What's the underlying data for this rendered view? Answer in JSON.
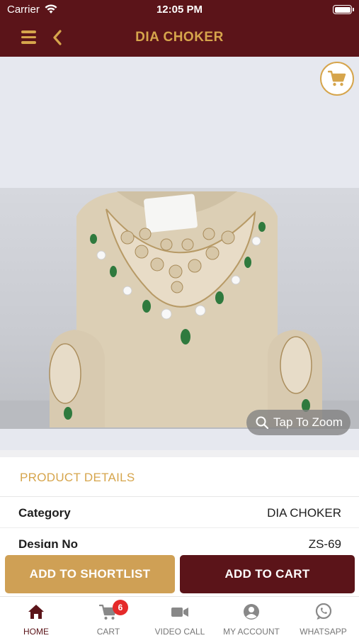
{
  "status": {
    "carrier": "Carrier",
    "time": "12:05 PM"
  },
  "nav": {
    "title": "DIA CHOKER",
    "menu_icon": "hamburger-icon",
    "back_icon": "chevron-left-icon"
  },
  "image": {
    "zoom_label": "Tap To Zoom",
    "cart_icon": "cart-icon"
  },
  "details": {
    "header": "PRODUCT DETAILS",
    "rows": [
      {
        "label": "Category",
        "value": "DIA CHOKER"
      },
      {
        "label": "Design No",
        "value": "ZS-69"
      }
    ]
  },
  "actions": {
    "shortlist_label": "ADD TO SHORTLIST",
    "cart_label": "ADD TO CART"
  },
  "tabs": [
    {
      "label": "HOME",
      "icon": "home-icon",
      "active": true
    },
    {
      "label": "CART",
      "icon": "cart-icon",
      "badge": "6"
    },
    {
      "label": "VIDEO CALL",
      "icon": "video-camera-icon"
    },
    {
      "label": "MY ACCOUNT",
      "icon": "user-icon"
    },
    {
      "label": "WHATSAPP",
      "icon": "whatsapp-icon"
    }
  ],
  "colors": {
    "maroon": "#5b1419",
    "gold": "#d6a54c",
    "badge": "#e52a2a"
  }
}
